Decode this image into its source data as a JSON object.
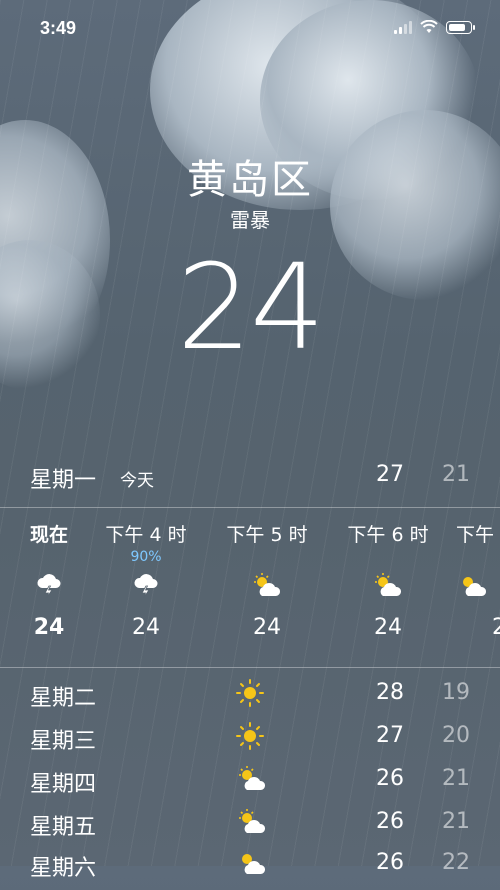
{
  "status": {
    "time": "3:49"
  },
  "location": {
    "city": "黄岛区",
    "condition": "雷暴",
    "temperature": "24"
  },
  "today": {
    "day": "星期一",
    "tag": "今天",
    "high": "27",
    "low": "21"
  },
  "hourly": [
    {
      "time": "现在",
      "precip": "",
      "icon": "thunderstorm-icon",
      "temp": "24"
    },
    {
      "time": "下午 4 时",
      "precip": "90%",
      "icon": "thunderstorm-icon",
      "temp": "24"
    },
    {
      "time": "下午 5 时",
      "precip": "",
      "icon": "partly-sunny-icon",
      "temp": "24"
    },
    {
      "time": "下午 6 时",
      "precip": "",
      "icon": "partly-sunny-icon",
      "temp": "24"
    },
    {
      "time": "下午",
      "precip": "",
      "icon": "partly-sunny-icon",
      "temp": "2"
    }
  ],
  "daily": [
    {
      "day": "星期二",
      "icon": "sunny-icon",
      "high": "28",
      "low": "19"
    },
    {
      "day": "星期三",
      "icon": "sunny-icon",
      "high": "27",
      "low": "20"
    },
    {
      "day": "星期四",
      "icon": "partly-sunny-icon",
      "high": "26",
      "low": "21"
    },
    {
      "day": "星期五",
      "icon": "partly-sunny-icon",
      "high": "26",
      "low": "21"
    },
    {
      "day": "星期六",
      "icon": "partly-sunny-icon",
      "high": "26",
      "low": "22"
    }
  ],
  "colors": {
    "precip": "#7ec8ff",
    "sun": "#f5c518"
  }
}
